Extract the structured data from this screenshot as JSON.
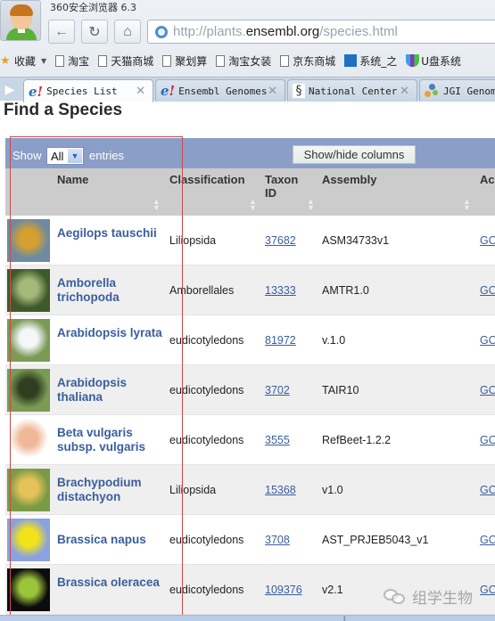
{
  "browser": {
    "app_title": "360安全浏览器 6.3",
    "url": {
      "prefix": "http://plants.",
      "domain": "ensembl.org",
      "path": "/species.html"
    },
    "bookmarks": [
      {
        "label": "收藏",
        "icon": "favorites-star-icon"
      },
      {
        "label": "淘宝",
        "icon": "page-icon"
      },
      {
        "label": "天猫商城",
        "icon": "page-icon"
      },
      {
        "label": "聚划算",
        "icon": "page-icon"
      },
      {
        "label": "淘宝女装",
        "icon": "page-icon"
      },
      {
        "label": "京东商城",
        "icon": "page-icon"
      },
      {
        "label": "系统_之",
        "icon": "system-site-icon"
      },
      {
        "label": "U盘系统",
        "icon": "u-disk-icon"
      }
    ],
    "tabs": [
      {
        "label": "Species List",
        "icon": "ensembl-icon",
        "active": true
      },
      {
        "label": "Ensembl Genomes",
        "icon": "ensembl-icon",
        "active": false
      },
      {
        "label": "National Center",
        "icon": "ncbi-icon",
        "active": false
      },
      {
        "label": "JGI Genome",
        "icon": "jgi-icon",
        "active": false
      }
    ],
    "tab_close_glyph": "✕"
  },
  "page": {
    "title": "Find a Species",
    "controls": {
      "show_label": "Show",
      "page_size_value": "All",
      "entries_label": "entries",
      "show_hide_columns_label": "Show/hide columns"
    },
    "table": {
      "columns": [
        "Name",
        "Classification",
        "Taxon ID",
        "Assembly",
        "Ac"
      ],
      "rows": [
        {
          "name": "Aegilops tauschii",
          "classification": "Liliopsida",
          "taxon_id": "37682",
          "assembly": "ASM34733v1",
          "action": "GO",
          "thumb_colors": [
            "#6e8aa0",
            "#d4a030"
          ]
        },
        {
          "name": "Amborella trichopoda",
          "classification": "Amborellales",
          "taxon_id": "13333",
          "assembly": "AMTR1.0",
          "action": "GO",
          "thumb_colors": [
            "#3f5a2a",
            "#a4b87a"
          ]
        },
        {
          "name": "Arabidopsis lyrata",
          "classification": "eudicotyledons",
          "taxon_id": "81972",
          "assembly": "v.1.0",
          "action": "GO",
          "thumb_colors": [
            "#7a9a55",
            "#f4f6f8"
          ]
        },
        {
          "name": "Arabidopsis thaliana",
          "classification": "eudicotyledons",
          "taxon_id": "3702",
          "assembly": "TAIR10",
          "action": "GO",
          "thumb_colors": [
            "#7a9a55",
            "#2f3d20"
          ]
        },
        {
          "name": "Beta vulgaris subsp. vulgaris",
          "classification": "eudicotyledons",
          "taxon_id": "3555",
          "assembly": "RefBeet-1.2.2",
          "action": "GO",
          "thumb_colors": [
            "#ffffff",
            "#f0b898"
          ]
        },
        {
          "name": "Brachypodium distachyon",
          "classification": "Liliopsida",
          "taxon_id": "15368",
          "assembly": "v1.0",
          "action": "GO",
          "thumb_colors": [
            "#7a9a45",
            "#e6c25a"
          ]
        },
        {
          "name": "Brassica napus",
          "classification": "eudicotyledons",
          "taxon_id": "3708",
          "assembly": "AST_PRJEB5043_v1",
          "action": "GO",
          "thumb_colors": [
            "#8aa2e0",
            "#f2e21a"
          ]
        },
        {
          "name": "Brassica oleracea",
          "classification": "eudicotyledons",
          "taxon_id": "109376",
          "assembly": "v2.1",
          "action": "GO",
          "thumb_colors": [
            "#0c0c0c",
            "#9cc43a"
          ]
        }
      ]
    }
  },
  "watermark": "组学生物"
}
